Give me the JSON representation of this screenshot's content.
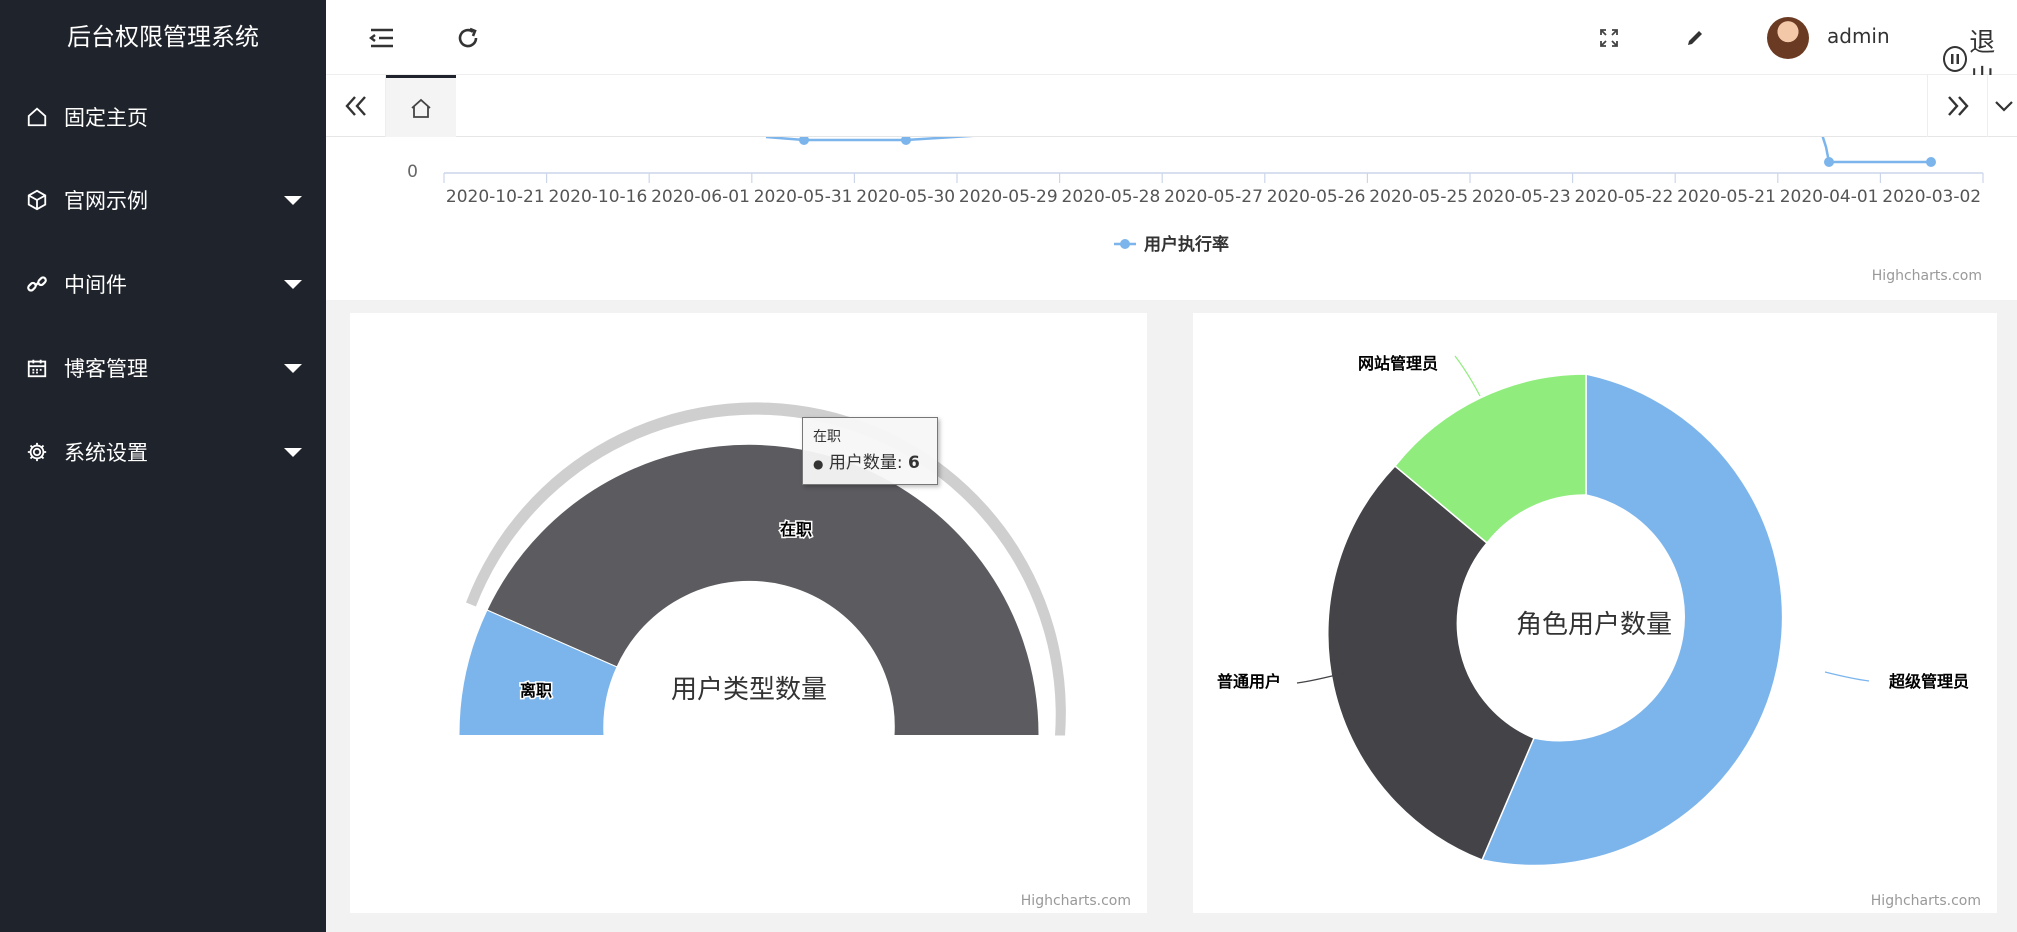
{
  "sidebar": {
    "brand": "后台权限管理系统",
    "items": [
      {
        "label": "固定主页",
        "icon": "home-icon",
        "has_submenu": false
      },
      {
        "label": "官网示例",
        "icon": "cube-icon",
        "has_submenu": true
      },
      {
        "label": "中间件",
        "icon": "link-icon",
        "has_submenu": true
      },
      {
        "label": "博客管理",
        "icon": "calendar-icon",
        "has_submenu": true
      },
      {
        "label": "系统设置",
        "icon": "gear-icon",
        "has_submenu": true
      }
    ]
  },
  "header": {
    "username": "admin",
    "logout_label": "退出"
  },
  "line_chart": {
    "y_zero_label": "0",
    "x_labels": [
      "2020-10-21",
      "2020-10-16",
      "2020-06-01",
      "2020-05-31",
      "2020-05-30",
      "2020-05-29",
      "2020-05-28",
      "2020-05-27",
      "2020-05-26",
      "2020-05-25",
      "2020-05-23",
      "2020-05-22",
      "2020-05-21",
      "2020-04-01",
      "2020-03-02"
    ],
    "legend": "用户执行率",
    "credit": "Highcharts.com",
    "color": "#7cb5ec"
  },
  "semi_donut": {
    "center_title": "用户类型数量",
    "credit": "Highcharts.com",
    "slices": [
      {
        "label": "离职",
        "color": "#7cb5ec"
      },
      {
        "label": "在职",
        "value": 6,
        "color": "#5b5b60"
      }
    ],
    "tooltip": {
      "title": "在职",
      "series": "用户数量",
      "value": "6"
    }
  },
  "pie_donut": {
    "center_title": "角色用户数量",
    "credit": "Highcharts.com",
    "slices": [
      {
        "label": "超级管理员",
        "color": "#7cb5ec"
      },
      {
        "label": "普通用户",
        "color": "#434348"
      },
      {
        "label": "网站管理员",
        "color": "#90ed7d"
      }
    ]
  },
  "chart_data": [
    {
      "type": "line",
      "x": [
        "2020-10-21",
        "2020-10-16",
        "2020-06-01",
        "2020-05-31",
        "2020-05-30",
        "2020-05-29",
        "2020-05-28",
        "2020-05-27",
        "2020-05-26",
        "2020-05-25",
        "2020-05-23",
        "2020-05-22",
        "2020-05-21",
        "2020-04-01",
        "2020-03-02"
      ],
      "series": [
        {
          "name": "用户执行率"
        }
      ],
      "legend": "bottom-center"
    },
    {
      "type": "pie",
      "title": "用户类型数量",
      "categories": [
        "离职",
        "在职"
      ],
      "values": [
        null,
        6
      ],
      "series_name": "用户数量"
    },
    {
      "type": "pie",
      "title": "角色用户数量",
      "categories": [
        "超级管理员",
        "普通用户",
        "网站管理员"
      ]
    }
  ]
}
